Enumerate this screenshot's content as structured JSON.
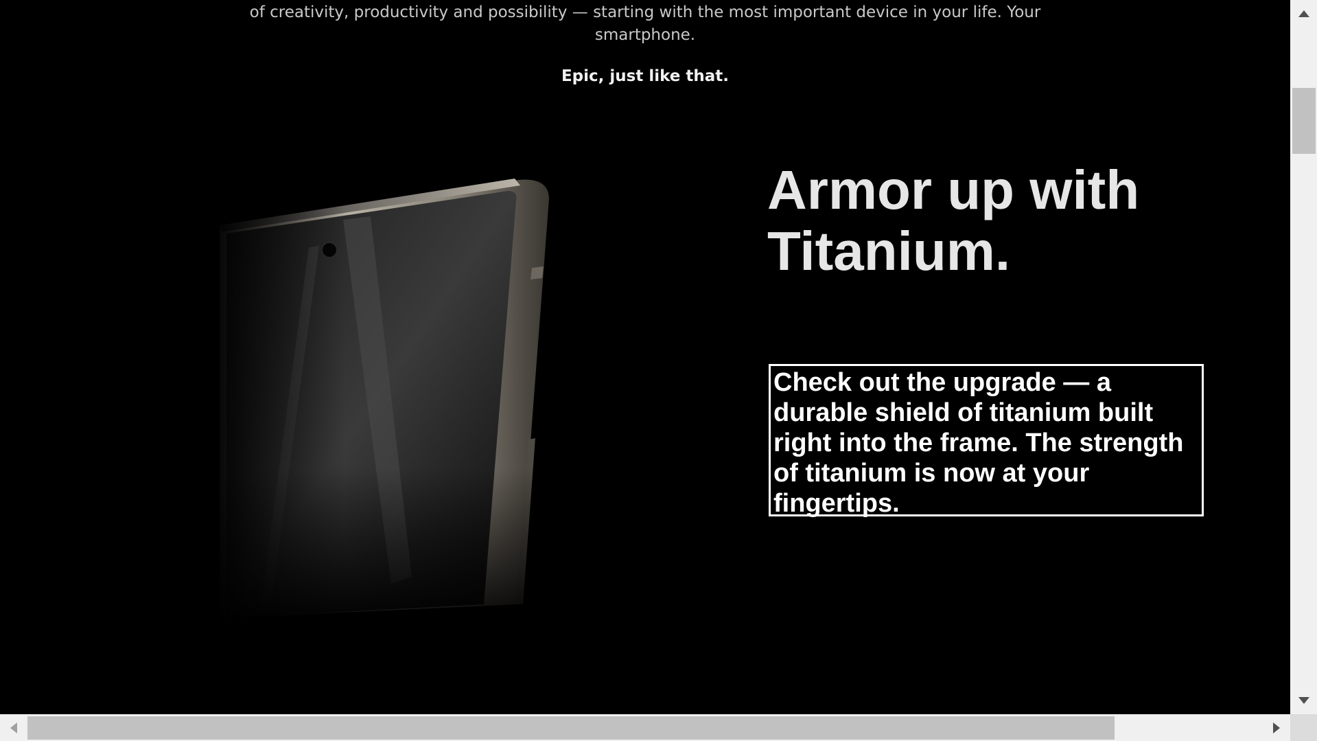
{
  "intro": {
    "line1": "of creativity, productivity and possibility — starting with the most important device in your life. Your",
    "line2": "smartphone."
  },
  "tagline": "Epic, just like that.",
  "feature": {
    "heading_line1": "Armor up with",
    "heading_line2": "Titanium.",
    "body_lines": [
      "Check out the upgrade — a",
      "durable shield of titanium built",
      "right into the frame. The strength",
      "of titanium is now at your",
      "fingertips."
    ],
    "image_subject": "titanium-phone-corner"
  },
  "scrollbars": {
    "vertical_position": 0.12,
    "horizontal_position": 0
  },
  "colors": {
    "background": "#000000",
    "heading": "#e6e6e6",
    "body": "#ffffff",
    "intro": "#c9c9c9",
    "scrollbar_track": "#f0f0f0",
    "scrollbar_thumb": "#c1c1c1"
  }
}
